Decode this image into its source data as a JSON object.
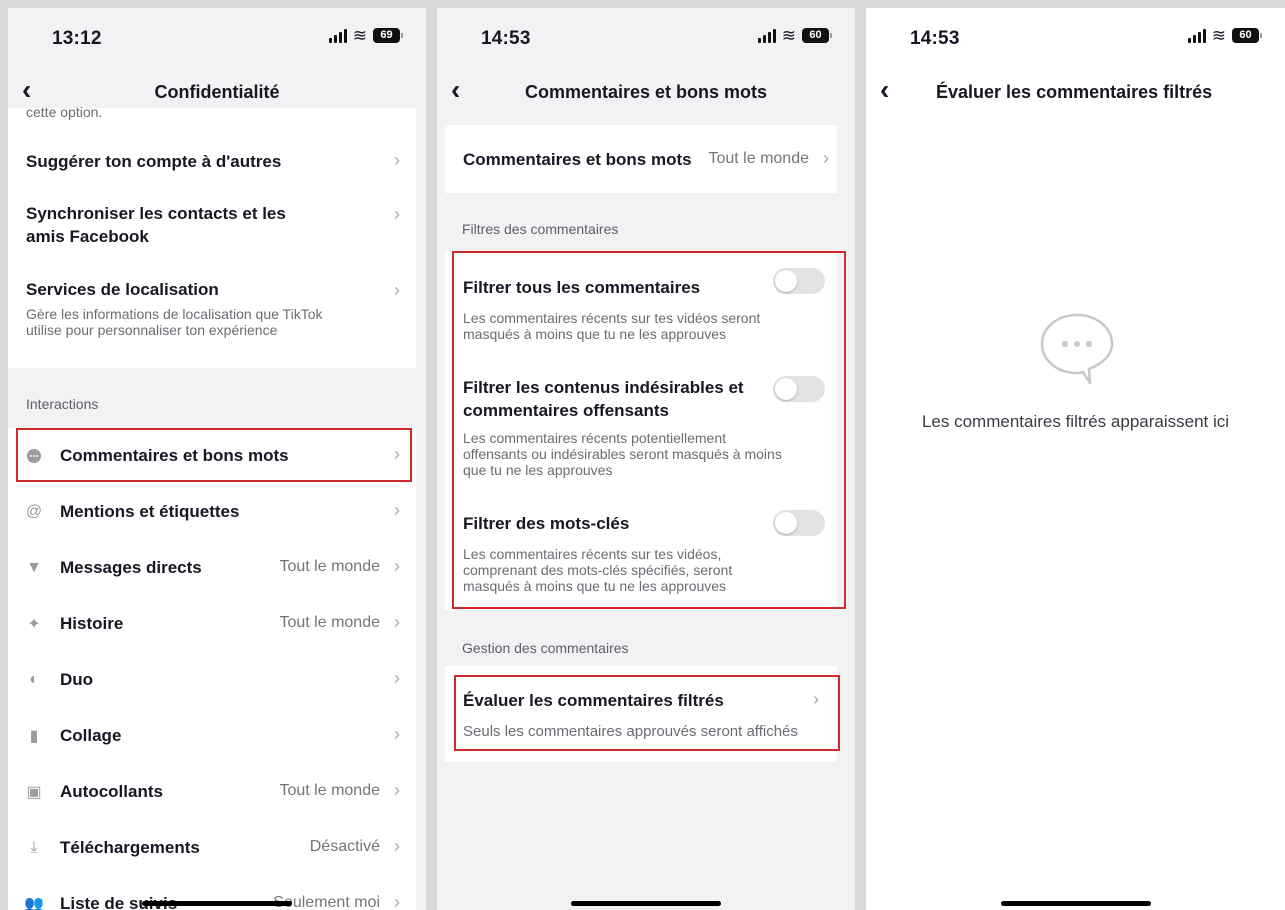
{
  "screens": [
    {
      "status": {
        "time": "13:12",
        "battery": "69"
      },
      "title": "Confidentialité",
      "clipped_text": "cette option.",
      "top_items": [
        {
          "label": "Suggérer ton compte à d'autres"
        },
        {
          "label_line1": "Synchroniser les contacts et les",
          "label_line2": "amis Facebook"
        },
        {
          "label": "Services de localisation",
          "sub_line1": "Gère les informations de localisation que TikTok",
          "sub_line2": "utilise pour personnaliser ton expérience"
        }
      ],
      "section": "Interactions",
      "items": [
        {
          "label": "Commentaires et bons mots",
          "value": "",
          "icon": "comment-bubble-icon"
        },
        {
          "label": "Mentions et étiquettes",
          "value": "",
          "icon": "at-icon"
        },
        {
          "label": "Messages directs",
          "value": "Tout le monde",
          "icon": "send-icon"
        },
        {
          "label": "Histoire",
          "value": "Tout le monde",
          "icon": "sparkle-icon"
        },
        {
          "label": "Duo",
          "value": "",
          "icon": "duet-icon"
        },
        {
          "label": "Collage",
          "value": "",
          "icon": "stitch-icon"
        },
        {
          "label": "Autocollants",
          "value": "Tout le monde",
          "icon": "sticker-icon"
        },
        {
          "label": "Téléchargements",
          "value": "Désactivé",
          "icon": "download-icon"
        },
        {
          "label": "Liste de suivis",
          "value": "Seulement moi",
          "icon": "people-icon"
        }
      ]
    },
    {
      "status": {
        "time": "14:53",
        "battery": "60"
      },
      "title": "Commentaires et bons mots",
      "setting": {
        "label": "Commentaires et bons mots",
        "value": "Tout le monde"
      },
      "filters_label": "Filtres des commentaires",
      "filters": [
        {
          "title": "Filtrer tous les commentaires",
          "desc_line1": "Les commentaires récents sur tes vidéos seront",
          "desc_line2": "masqués à moins que tu ne les approuves"
        },
        {
          "title_line1": "Filtrer les contenus indésirables et",
          "title_line2": "commentaires offensants",
          "desc_line1": "Les commentaires récents potentiellement",
          "desc_line2": "offensants ou indésirables seront masqués à moins",
          "desc_line3": "que tu ne les approuves"
        },
        {
          "title": "Filtrer des mots-clés",
          "desc_line1": "Les commentaires récents sur tes vidéos,",
          "desc_line2": "comprenant des mots-clés spécifiés, seront",
          "desc_line3": "masqués à moins que tu ne les approuves"
        }
      ],
      "management_label": "Gestion des commentaires",
      "review": {
        "title": "Évaluer les commentaires filtrés",
        "desc": "Seuls les commentaires approuvés seront affichés"
      }
    },
    {
      "status": {
        "time": "14:53",
        "battery": "60"
      },
      "title": "Évaluer les commentaires filtrés",
      "empty_text": "Les commentaires filtrés apparaissent ici",
      "empty_icon": "chat-bubble-icon"
    }
  ],
  "colors": {
    "highlight": "#cf2a2a",
    "background": "#f2f2f4"
  }
}
